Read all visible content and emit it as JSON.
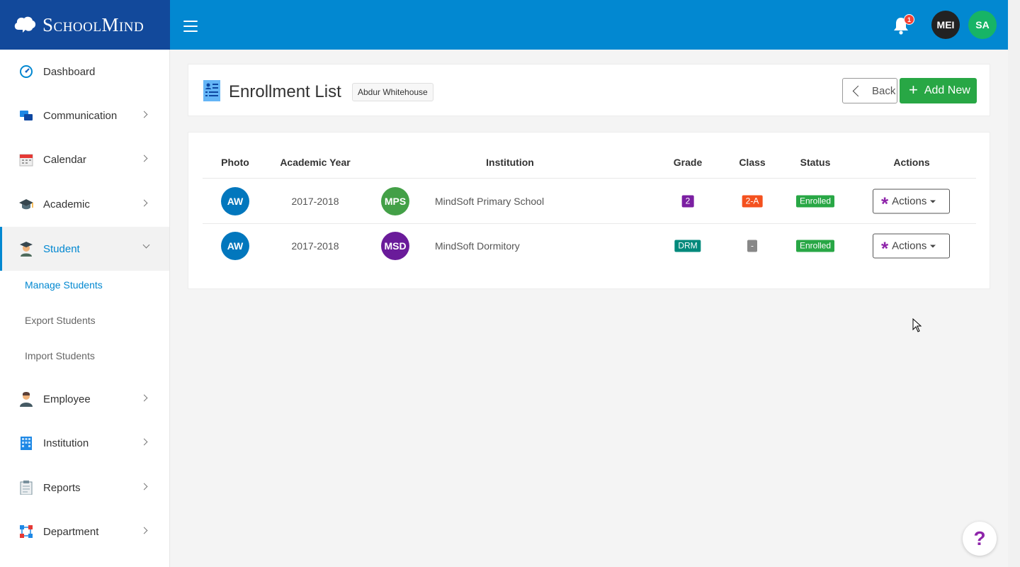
{
  "brand": {
    "name": "SchoolMind"
  },
  "topbar": {
    "notification_count": "1",
    "avatars": [
      {
        "initials": "MEI",
        "color": "#222222"
      },
      {
        "initials": "SA",
        "color": "#17b466"
      }
    ]
  },
  "sidebar": {
    "items": [
      {
        "label": "Dashboard",
        "icon": "dashboard-icon"
      },
      {
        "label": "Communication",
        "icon": "chat-icon"
      },
      {
        "label": "Calendar",
        "icon": "calendar-icon"
      },
      {
        "label": "Academic",
        "icon": "graduation-cap-icon"
      },
      {
        "label": "Student",
        "icon": "student-icon"
      },
      {
        "label": "Employee",
        "icon": "employee-icon"
      },
      {
        "label": "Institution",
        "icon": "building-icon"
      },
      {
        "label": "Reports",
        "icon": "clipboard-icon"
      },
      {
        "label": "Department",
        "icon": "department-icon"
      }
    ],
    "student_sub": [
      "Manage Students",
      "Export Students",
      "Import Students"
    ]
  },
  "header": {
    "title": "Enrollment List",
    "student_name": "Abdur Whitehouse",
    "back_label": "Back",
    "add_label": "Add New"
  },
  "table": {
    "columns": [
      "Photo",
      "Academic Year",
      "Institution",
      "Grade",
      "Class",
      "Status",
      "Actions"
    ],
    "rows": [
      {
        "photo": "AW",
        "photo_color": "#0277bd",
        "year": "2017-2018",
        "inst_abbr": "MPS",
        "inst_color": "#43a047",
        "institution": "MindSoft Primary School",
        "grade": "2",
        "grade_color": "#7b1fa2",
        "class": "2-A",
        "class_color": "#f4511e",
        "status": "Enrolled",
        "status_color": "#28a745",
        "actions_label": "Actions"
      },
      {
        "photo": "AW",
        "photo_color": "#0277bd",
        "year": "2017-2018",
        "inst_abbr": "MSD",
        "inst_color": "#6a1b9a",
        "institution": "MindSoft Dormitory",
        "grade": "DRM",
        "grade_color": "#00897b",
        "class": "-",
        "class_color": "#888888",
        "status": "Enrolled",
        "status_color": "#28a745",
        "actions_label": "Actions"
      }
    ]
  },
  "help": {
    "label": "?"
  }
}
